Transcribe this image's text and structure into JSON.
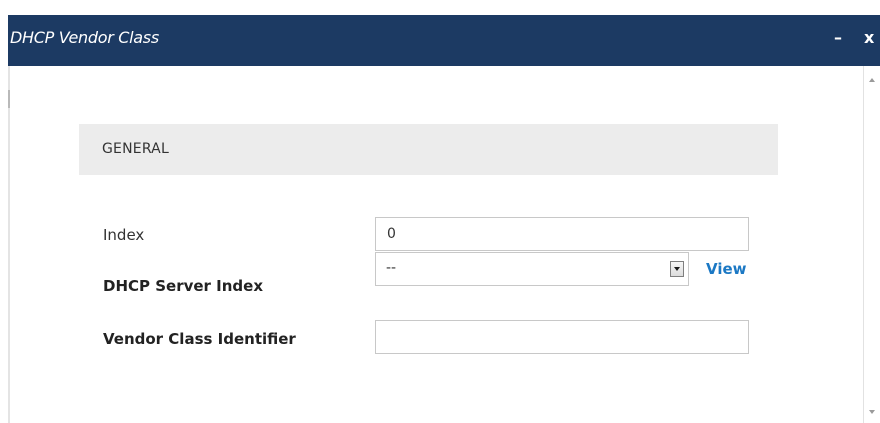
{
  "dialog": {
    "title": "DHCP Vendor Class",
    "minimize_label": "–",
    "close_label": "x"
  },
  "section": {
    "title": "GENERAL"
  },
  "fields": {
    "index": {
      "label": "Index",
      "value": "0"
    },
    "dhcp_server_index": {
      "label": "DHCP Server Index",
      "selected": "--",
      "link_label": "View"
    },
    "vendor_class_identifier": {
      "label": "Vendor Class Identifier",
      "value": ""
    }
  },
  "colors": {
    "titlebar": "#1c3a63",
    "section_header_bg": "#ececec",
    "link": "#1b78c4"
  },
  "icons": {
    "dropdown": "chevron-down-icon",
    "scroll_up": "scroll-up-arrow-icon",
    "scroll_down": "scroll-down-arrow-icon"
  }
}
